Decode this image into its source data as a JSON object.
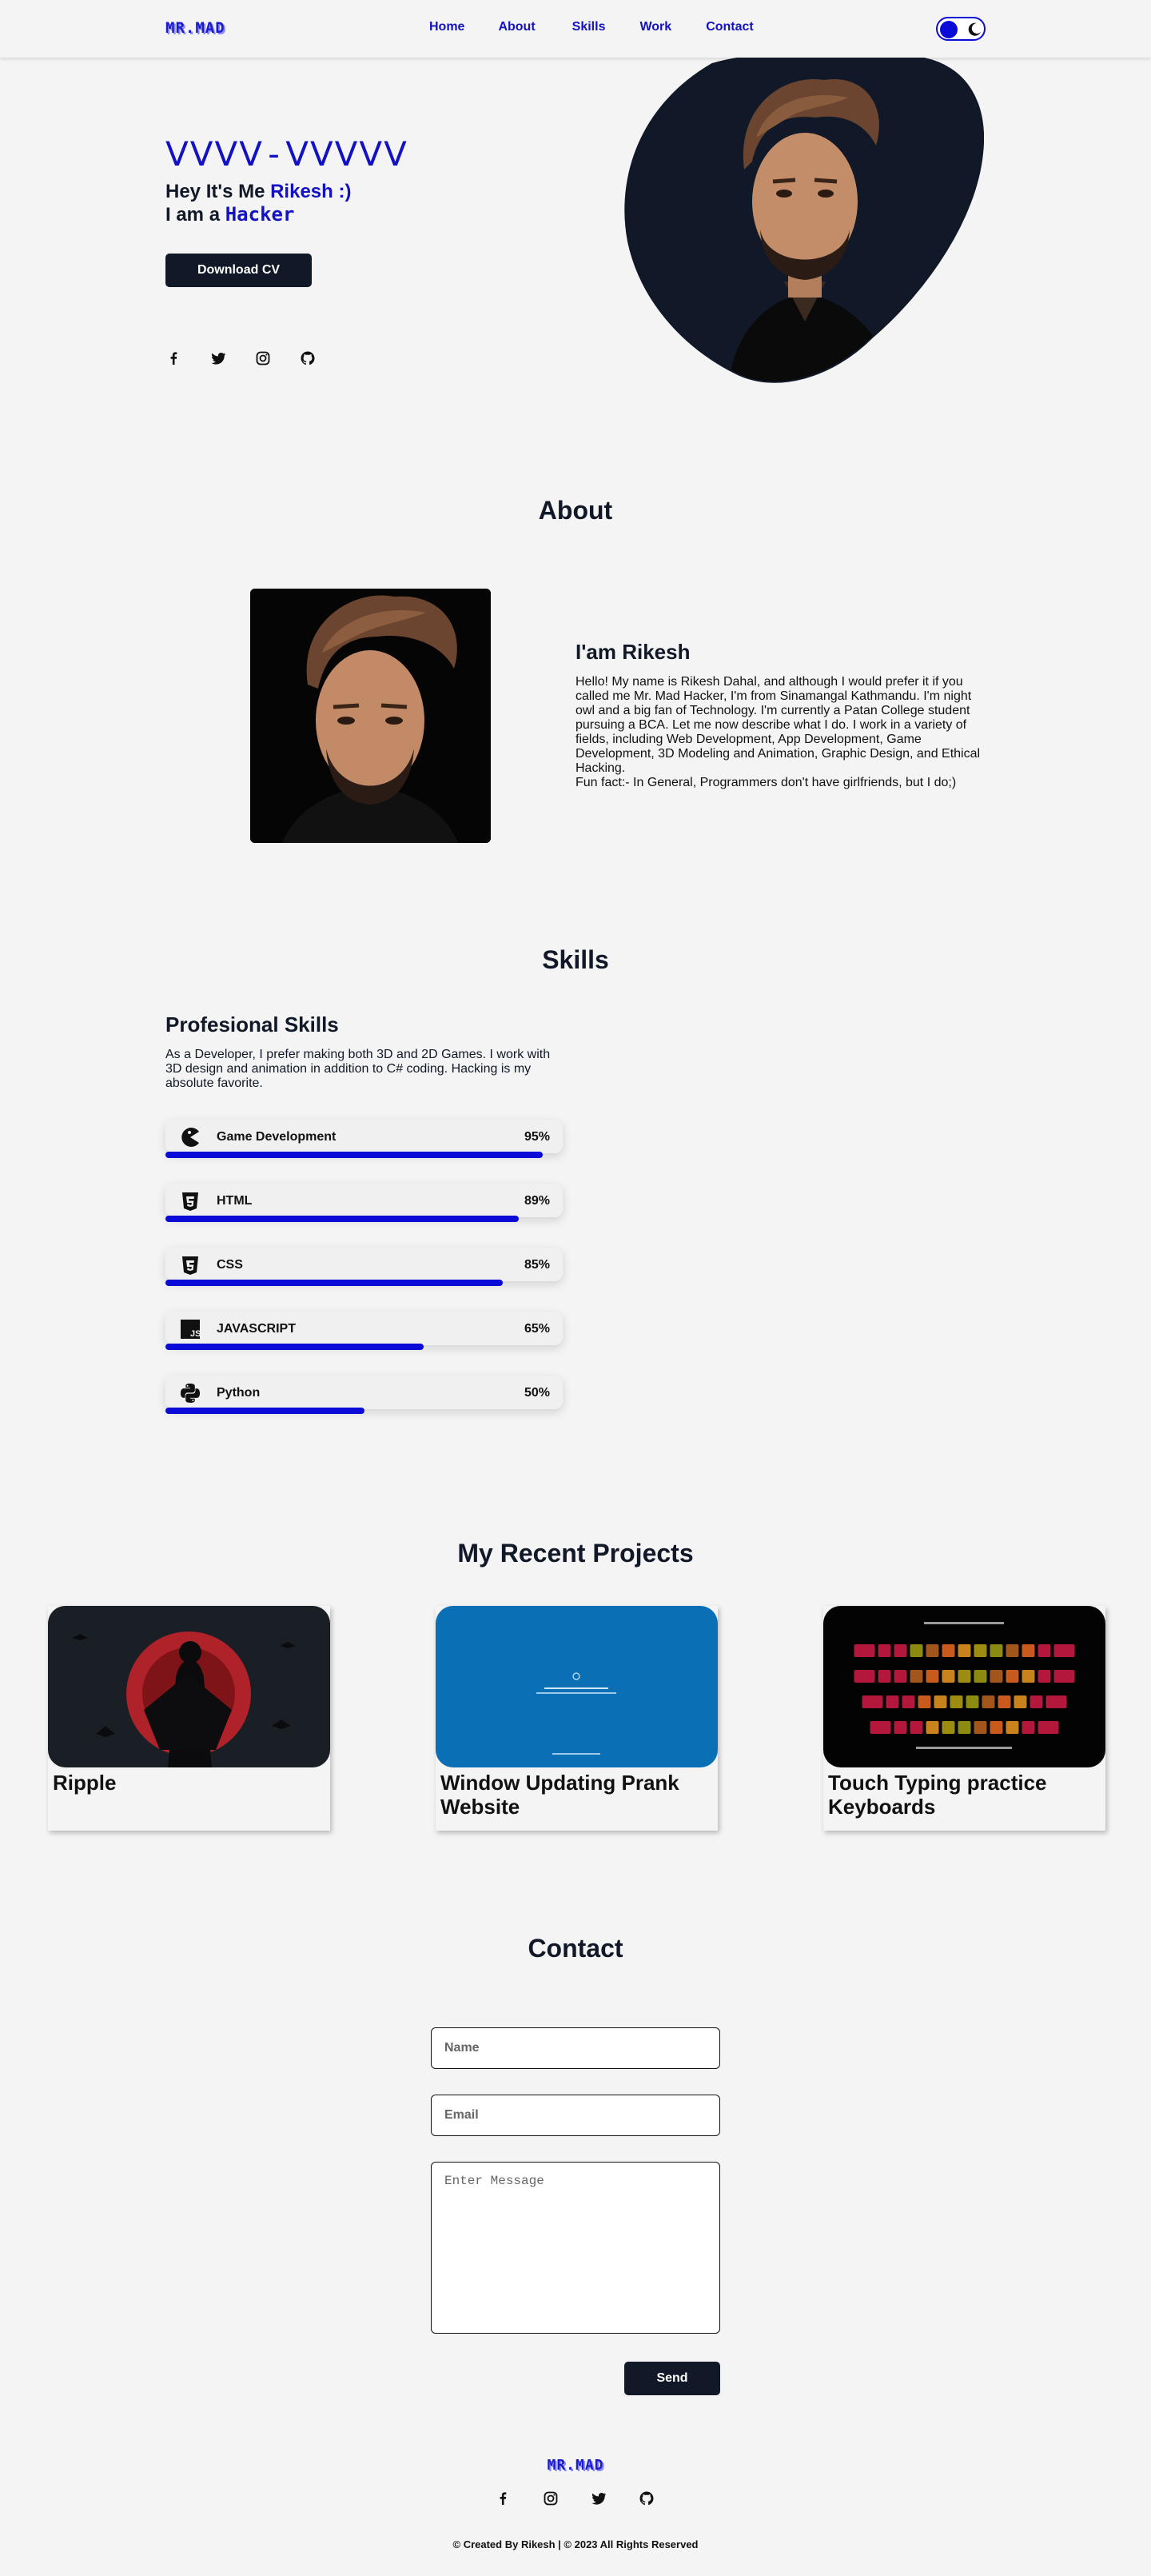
{
  "nav": {
    "logo": "MR.MAD",
    "links": [
      "Home",
      "About",
      "Skills",
      "Work",
      "Contact"
    ],
    "theme_toggle_icon": "moon-icon"
  },
  "hero": {
    "title": "ᐯᐯᐯᐯ-ᐯᐯᐯᐯᐯ",
    "greeting_prefix": "Hey It's Me ",
    "greeting_name": "Rikesh :)",
    "role_prefix": "I am a ",
    "role": "Hacker",
    "cv_button": "Download CV",
    "social_icons": [
      "facebook-icon",
      "twitter-icon",
      "instagram-icon",
      "github-icon"
    ]
  },
  "about": {
    "title": "About",
    "name": "I'am Rikesh",
    "text": "Hello! My name is Rikesh Dahal, and although I would prefer it if you called me Mr. Mad Hacker, I'm from Sinamangal Kathmandu. I'm night owl and a big fan of Technology. I'm currently a Patan College student pursuing a BCA. Let me now describe what I do. I work in a variety of fields, including Web Development, App Development, Game Development, 3D Modeling and Animation, Graphic Design, and Ethical Hacking.",
    "fun_fact": "Fun fact:- In General, Programmers don't have girlfriends, but I do;)"
  },
  "skills": {
    "title": "Skills",
    "heading": "Profesional Skills",
    "description": "As a Developer, I prefer making both 3D and 2D Games. I work with 3D design and animation in addition to C# coding. Hacking is my absolute favorite.",
    "items": [
      {
        "name": "Game Development",
        "percent": "95%",
        "level": 0.95,
        "icon": "pacman-icon"
      },
      {
        "name": "HTML",
        "percent": "89%",
        "level": 0.89,
        "icon": "html5-icon"
      },
      {
        "name": "CSS",
        "percent": "85%",
        "level": 0.85,
        "icon": "css3-icon"
      },
      {
        "name": "JAVASCRIPT",
        "percent": "65%",
        "level": 0.65,
        "icon": "js-icon"
      },
      {
        "name": "Python",
        "percent": "50%",
        "level": 0.5,
        "icon": "python-icon"
      }
    ]
  },
  "projects": {
    "title": "My Recent Projects",
    "items": [
      {
        "title": "Ripple"
      },
      {
        "title": "Window Updating Prank Website"
      },
      {
        "title": "Touch Typing practice Keyboards"
      }
    ]
  },
  "contact": {
    "title": "Contact",
    "name_placeholder": "Name",
    "email_placeholder": "Email",
    "message_placeholder": "Enter Message",
    "send_button": "Send"
  },
  "footer": {
    "logo": "MR.MAD",
    "social_icons": [
      "facebook-icon",
      "instagram-icon",
      "twitter-icon",
      "github-icon"
    ],
    "copyright": "© Created By Rikesh | © 2023 All Rights Reserved"
  },
  "colors": {
    "accent": "#1212c4",
    "dark": "#111827",
    "background": "#f4f4f4"
  }
}
